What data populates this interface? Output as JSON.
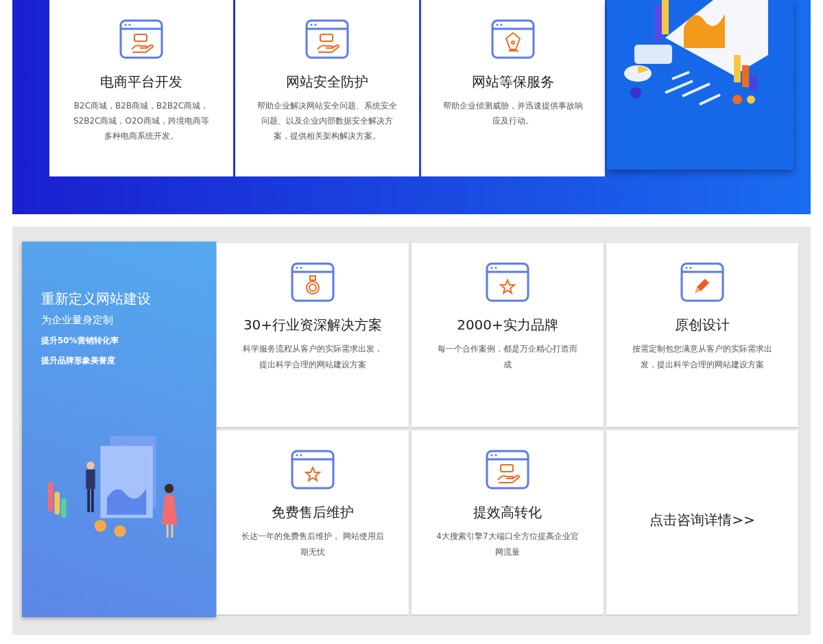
{
  "top_services": [
    {
      "title": "电商平台开发",
      "desc": "B2C商城，B2B商城，B2B2C商城，S2B2C商城，O2O商城，跨境电商等多种电商系统开发。"
    },
    {
      "title": "网站安全防护",
      "desc": "帮助企业解决网站安全问题、系统安全问题、以及企业内部数据安全解决方案，提供相关架构解决方案。"
    },
    {
      "title": "网站等保服务",
      "desc": "帮助企业侦测威胁，并迅速提供事故响应及行动。"
    }
  ],
  "promo": {
    "title": "重新定义网站建设",
    "subtitle": "为企业量身定制",
    "bullets": [
      "提升50%营销转化率",
      "提升品牌形象美誉度"
    ]
  },
  "features": [
    {
      "kind": "card",
      "title": "30+行业资深解决方案",
      "desc": "科学服务流程从客户的实际需求出发，提出科学合理的网站建设方案"
    },
    {
      "kind": "card",
      "title": "2000+实力品牌",
      "desc": "每一个合作案例，都是万企精心打造而成"
    },
    {
      "kind": "card",
      "title": "原创设计",
      "desc": "按需定制包您满意从客户的实际需求出发，提出科学合理的网站建设方案"
    },
    {
      "kind": "card",
      "title": "免费售后维护",
      "desc": "长达一年的免费售后维护， 网站使用后期无忧"
    },
    {
      "kind": "card",
      "title": "提效高转化",
      "desc": "4大搜索引擎7大端口全方位提高企业官网流量"
    },
    {
      "kind": "link",
      "title": "点击咨询详情>>"
    }
  ]
}
